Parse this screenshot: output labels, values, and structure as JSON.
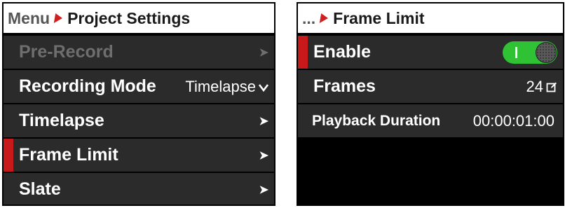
{
  "left": {
    "breadcrumb": {
      "parent": "Menu",
      "title": "Project Settings"
    },
    "items": [
      {
        "label": "Pre-Record",
        "value": "",
        "disabled": true,
        "selected": false
      },
      {
        "label": "Recording Mode",
        "value": "Timelapse",
        "disabled": false,
        "selected": false
      },
      {
        "label": "Timelapse",
        "value": "",
        "disabled": false,
        "selected": false
      },
      {
        "label": "Frame Limit",
        "value": "",
        "disabled": false,
        "selected": true
      },
      {
        "label": "Slate",
        "value": "",
        "disabled": false,
        "selected": false
      }
    ]
  },
  "right": {
    "breadcrumb": {
      "parent": "...",
      "title": "Frame Limit"
    },
    "enable": {
      "label": "Enable",
      "on": true
    },
    "frames": {
      "label": "Frames",
      "value": "24"
    },
    "playback": {
      "label": "Playback Duration",
      "value": "00:00:01:00"
    }
  },
  "icons": {
    "chevron": "chevron-right-icon",
    "dropdown": "chevron-down-icon",
    "edit": "edit-icon"
  },
  "colors": {
    "accent": "#c81a1a",
    "row": "#2b2b2b",
    "toggle_on": "#2ec234"
  }
}
